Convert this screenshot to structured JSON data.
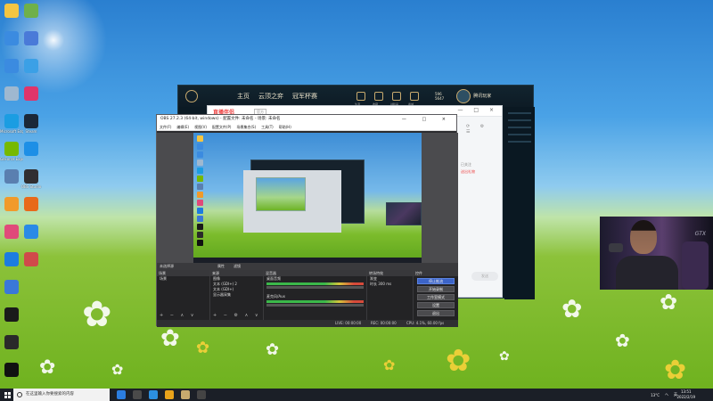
{
  "desktop": {
    "icons_left": [
      {
        "label": "",
        "color": "#f4c542"
      },
      {
        "label": "",
        "color": "#3b8be0"
      },
      {
        "label": "",
        "color": "#3b8be0"
      },
      {
        "label": "",
        "color": "#9fb8d0"
      },
      {
        "label": "Microsoft Edge",
        "color": "#1b9de2"
      },
      {
        "label": "GeForce Experience",
        "color": "#76b900"
      },
      {
        "label": "",
        "color": "#5a7fb0"
      },
      {
        "label": "",
        "color": "#f19a2a"
      },
      {
        "label": "",
        "color": "#e04a7a"
      },
      {
        "label": "",
        "color": "#1c7ce0"
      },
      {
        "label": "",
        "color": "#3a78d8"
      },
      {
        "label": "",
        "color": "#1a1a1a"
      },
      {
        "label": "",
        "color": "#2a2a2a"
      },
      {
        "label": "",
        "color": "#111111"
      }
    ],
    "icons_right": [
      {
        "label": "",
        "color": "#6fb04a"
      },
      {
        "label": "",
        "color": "#4a7ad8"
      },
      {
        "label": "",
        "color": "#3ba0e6"
      },
      {
        "label": "",
        "color": "#e0356a"
      },
      {
        "label": "Steam",
        "color": "#1b2838"
      },
      {
        "label": "",
        "color": "#1d8fe6"
      },
      {
        "label": "OBS Studio",
        "color": "#302e31"
      },
      {
        "label": "",
        "color": "#e86a1a"
      },
      {
        "label": "",
        "color": "#2a8ae6"
      },
      {
        "label": "",
        "color": "#d04a4a"
      }
    ]
  },
  "game_client": {
    "nav": [
      "主页",
      "云顶之弈",
      "冠军杯赛"
    ],
    "icons": [
      "生涯",
      "收藏",
      "战利品",
      "商城"
    ],
    "coins": [
      "596",
      "5647"
    ],
    "player_name": "腾讯玩家"
  },
  "chat_window": {
    "brand": "直播伴侣",
    "tag": "官方",
    "controls": "— □ ×",
    "side_texts": [
      "已关注"
    ],
    "side_link": "送出礼物",
    "send_label": "发送"
  },
  "obs": {
    "title": "OBS 27.2.3 (64-bit, windows) - 配置文件: 未命名 - 场景: 未命名",
    "controls": "— □ ×",
    "menu": [
      "文件(F)",
      "编辑(E)",
      "视图(V)",
      "配置文件(P)",
      "场景集合(S)",
      "工具(T)",
      "帮助(H)"
    ],
    "tabs": {
      "left": "未选择源",
      "props": "属性",
      "filters": "滤镜"
    },
    "docks": {
      "scenes": {
        "title": "场景",
        "items": [
          "场景"
        ]
      },
      "sources": {
        "title": "来源",
        "items": [
          "图像",
          "文本 (GDI+) 2",
          "文本 (GDI+)",
          "显示器采集"
        ]
      },
      "mixer": {
        "title": "混音器",
        "channels": [
          "桌面音频",
          "麦克风/Aux"
        ]
      },
      "transitions": {
        "title": "转场特效",
        "type": "渐变",
        "duration_label": "时长",
        "duration": "300 ms"
      },
      "controls": {
        "title": "控件",
        "buttons": [
          "停止推流",
          "开始录制",
          "工作室模式",
          "设置",
          "退出"
        ]
      }
    },
    "status": {
      "live": "LIVE: 00:00:00",
      "rec": "REC: 00:00:00",
      "cpu": "CPU: 4.1%, 60.00 fps"
    }
  },
  "webcam": {
    "overlay_text": "GTX"
  },
  "taskbar": {
    "search_placeholder": "在这里输入你要搜索的内容",
    "apps": [
      {
        "color": "#2b7de0"
      },
      {
        "color": "#4a4a4a"
      },
      {
        "color": "#2c8fe0"
      },
      {
        "color": "#e8a21a"
      },
      {
        "color": "#c8aa6e"
      },
      {
        "color": "#444444"
      }
    ],
    "tray": [
      "13°C",
      "ヘ",
      "英"
    ],
    "time": "13:51",
    "date": "2022/2/19"
  }
}
